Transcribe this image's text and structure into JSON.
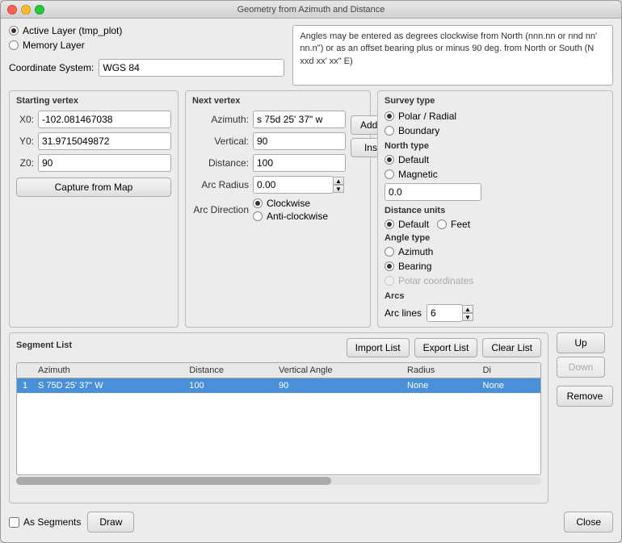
{
  "window": {
    "title": "Geometry from Azimuth and Distance",
    "traffic": [
      "close",
      "minimize",
      "maximize"
    ]
  },
  "info_box": {
    "text": "Angles may be entered as degrees clockwise from North (nnn.nn or nnd nn' nn.n\") or as an offset bearing plus or minus 90 deg. from  North or South (N xxd xx' xx\" E)"
  },
  "layer": {
    "active_label": "Active Layer (tmp_plot)",
    "memory_label": "Memory Layer",
    "coord_system_label": "Coordinate System:",
    "coord_system_value": "WGS 84"
  },
  "starting_vertex": {
    "label": "Starting vertex",
    "x0_label": "X0:",
    "x0_value": "-102.081467038",
    "y0_label": "Y0:",
    "y0_value": "31.9715049872",
    "z0_label": "Z0:",
    "z0_value": "90",
    "capture_btn": "Capture from Map"
  },
  "next_vertex": {
    "label": "Next vertex",
    "azimuth_label": "Azimuth:",
    "azimuth_value": "s 75d 25' 37\" w",
    "vertical_label": "Vertical:",
    "vertical_value": "90",
    "distance_label": "Distance:",
    "distance_value": "100",
    "arc_radius_label": "Arc Radius",
    "arc_radius_value": "0.00",
    "arc_direction_label": "Arc Direction",
    "clockwise_label": "Clockwise",
    "anticlockwise_label": "Anti-clockwise",
    "add_bottom_btn": "Add to Bottom",
    "insert_above_btn": "Insert above"
  },
  "survey": {
    "label": "Survey type",
    "polar_label": "Polar / Radial",
    "boundary_label": "Boundary",
    "north_label": "North type",
    "default_north_label": "Default",
    "magnetic_label": "Magnetic",
    "north_value": "0.0",
    "distance_label": "Distance units",
    "default_dist_label": "Default",
    "feet_label": "Feet",
    "angle_label": "Angle type",
    "azimuth_angle_label": "Azimuth",
    "bearing_label": "Bearing",
    "polar_coord_label": "Polar coordinates",
    "arcs_label": "Arcs",
    "arc_lines_label": "Arc lines",
    "arc_lines_value": "6"
  },
  "segment": {
    "label": "Segment List",
    "import_btn": "Import List",
    "export_btn": "Export List",
    "clear_btn": "Clear List",
    "up_btn": "Up",
    "down_btn": "Down",
    "remove_btn": "Remove",
    "columns": [
      "Azimuth",
      "Distance",
      "Vertical Angle",
      "Radius",
      "Di"
    ],
    "rows": [
      {
        "num": "1",
        "azimuth": "S 75D 25' 37\"\nW",
        "distance": "100",
        "vertical": "90",
        "radius": "None",
        "di": "None"
      }
    ]
  },
  "bottom": {
    "as_segments_label": "As Segments",
    "draw_btn": "Draw",
    "close_btn": "Close"
  }
}
